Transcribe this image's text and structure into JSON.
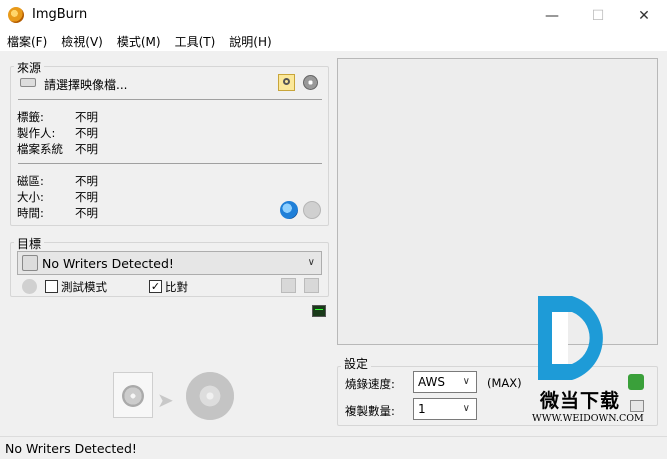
{
  "window": {
    "title": "ImgBurn",
    "minimize": "—",
    "maximize": "☐",
    "close": "✕"
  },
  "menu": [
    {
      "label": "檔案(F)"
    },
    {
      "label": "檢視(V)"
    },
    {
      "label": "模式(M)"
    },
    {
      "label": "工具(T)"
    },
    {
      "label": "說明(H)"
    }
  ],
  "source": {
    "title": "來源",
    "select_label": "請選擇映像檔...",
    "fields": [
      {
        "label": "標籤:",
        "value": "不明"
      },
      {
        "label": "製作人:",
        "value": "不明"
      },
      {
        "label": "檔案系統",
        "value": "不明"
      }
    ],
    "fields2": [
      {
        "label": "磁區:",
        "value": "不明"
      },
      {
        "label": "大小:",
        "value": "不明"
      },
      {
        "label": "時間:",
        "value": "不明"
      }
    ]
  },
  "target": {
    "title": "目標",
    "device": "No Writers Detected!",
    "test_mode_label": "測試模式",
    "test_mode_checked": false,
    "verify_label": "比對",
    "verify_checked": true
  },
  "settings": {
    "title": "設定",
    "speed_label": "燒錄速度:",
    "speed_value": "AWS",
    "speed_max": "(MAX)",
    "copies_label": "複製數量:",
    "copies_value": "1"
  },
  "watermark": {
    "text": "微当下载",
    "url": "WWW.WEIDOWN.COM"
  },
  "status": "No Writers Detected!"
}
